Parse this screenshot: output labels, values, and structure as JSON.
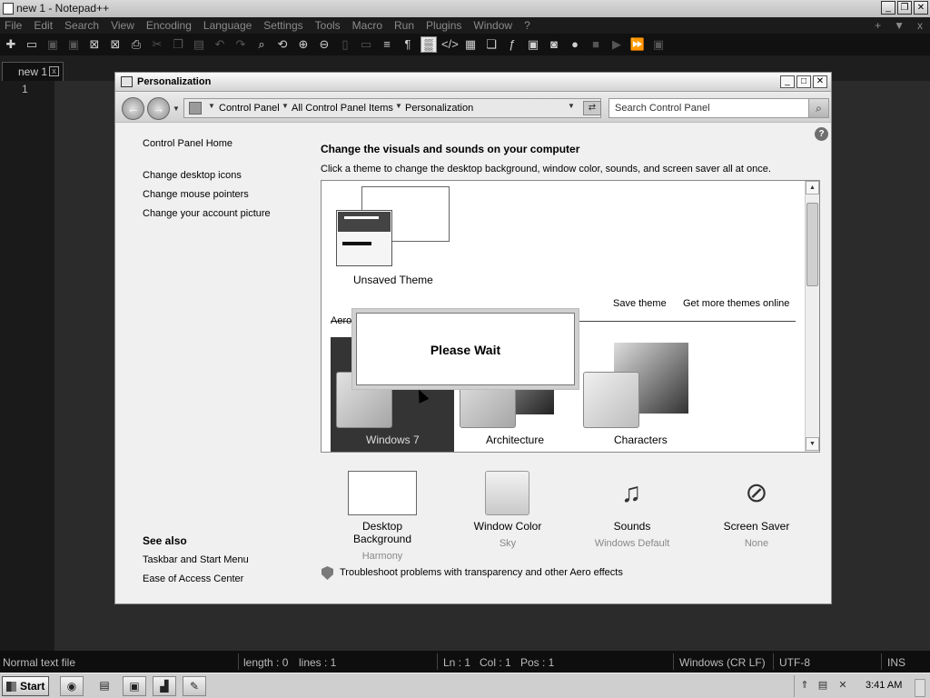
{
  "notepad": {
    "title": "new 1 - Notepad++",
    "menu": [
      "File",
      "Edit",
      "Search",
      "View",
      "Encoding",
      "Language",
      "Settings",
      "Tools",
      "Macro",
      "Run",
      "Plugins",
      "Window",
      "?"
    ],
    "menu_right": [
      "+",
      "▼",
      "x"
    ],
    "tab": "new 1",
    "line_number": "1"
  },
  "status": {
    "mode": "Normal text file",
    "length": "length : 0",
    "lines": "lines : 1",
    "ln": "Ln : 1",
    "col": "Col : 1",
    "pos": "Pos : 1",
    "eol": "Windows (CR LF)",
    "encoding": "UTF-8",
    "ins": "INS"
  },
  "taskbar": {
    "start": "Start",
    "clock": "3:41 AM"
  },
  "window": {
    "title": "Personalization",
    "breadcrumb": [
      "Control Panel",
      "All Control Panel Items",
      "Personalization"
    ],
    "search_placeholder": "Search Control Panel"
  },
  "left_pane": {
    "home": "Control Panel Home",
    "links": [
      "Change desktop icons",
      "Change mouse pointers",
      "Change your account picture"
    ],
    "see_also_title": "See also",
    "see_also": [
      "Taskbar and Start Menu",
      "Ease of Access Center"
    ]
  },
  "main": {
    "heading": "Change the visuals and sounds on your computer",
    "subheading": "Click a theme to change the desktop background, window color, sounds, and screen saver all at once.",
    "unsaved_theme": "Unsaved Theme",
    "save_theme": "Save theme",
    "more_themes": "Get more themes online",
    "aero_label": "Aero",
    "themes": [
      "Windows 7",
      "Architecture",
      "Characters"
    ],
    "wait": "Please Wait"
  },
  "bottom": {
    "items": [
      {
        "label": "Desktop Background",
        "sub": "Harmony"
      },
      {
        "label": "Window Color",
        "sub": "Sky"
      },
      {
        "label": "Sounds",
        "sub": "Windows Default"
      },
      {
        "label": "Screen Saver",
        "sub": "None"
      }
    ],
    "troubleshoot": "Troubleshoot problems with transparency and other Aero effects"
  }
}
